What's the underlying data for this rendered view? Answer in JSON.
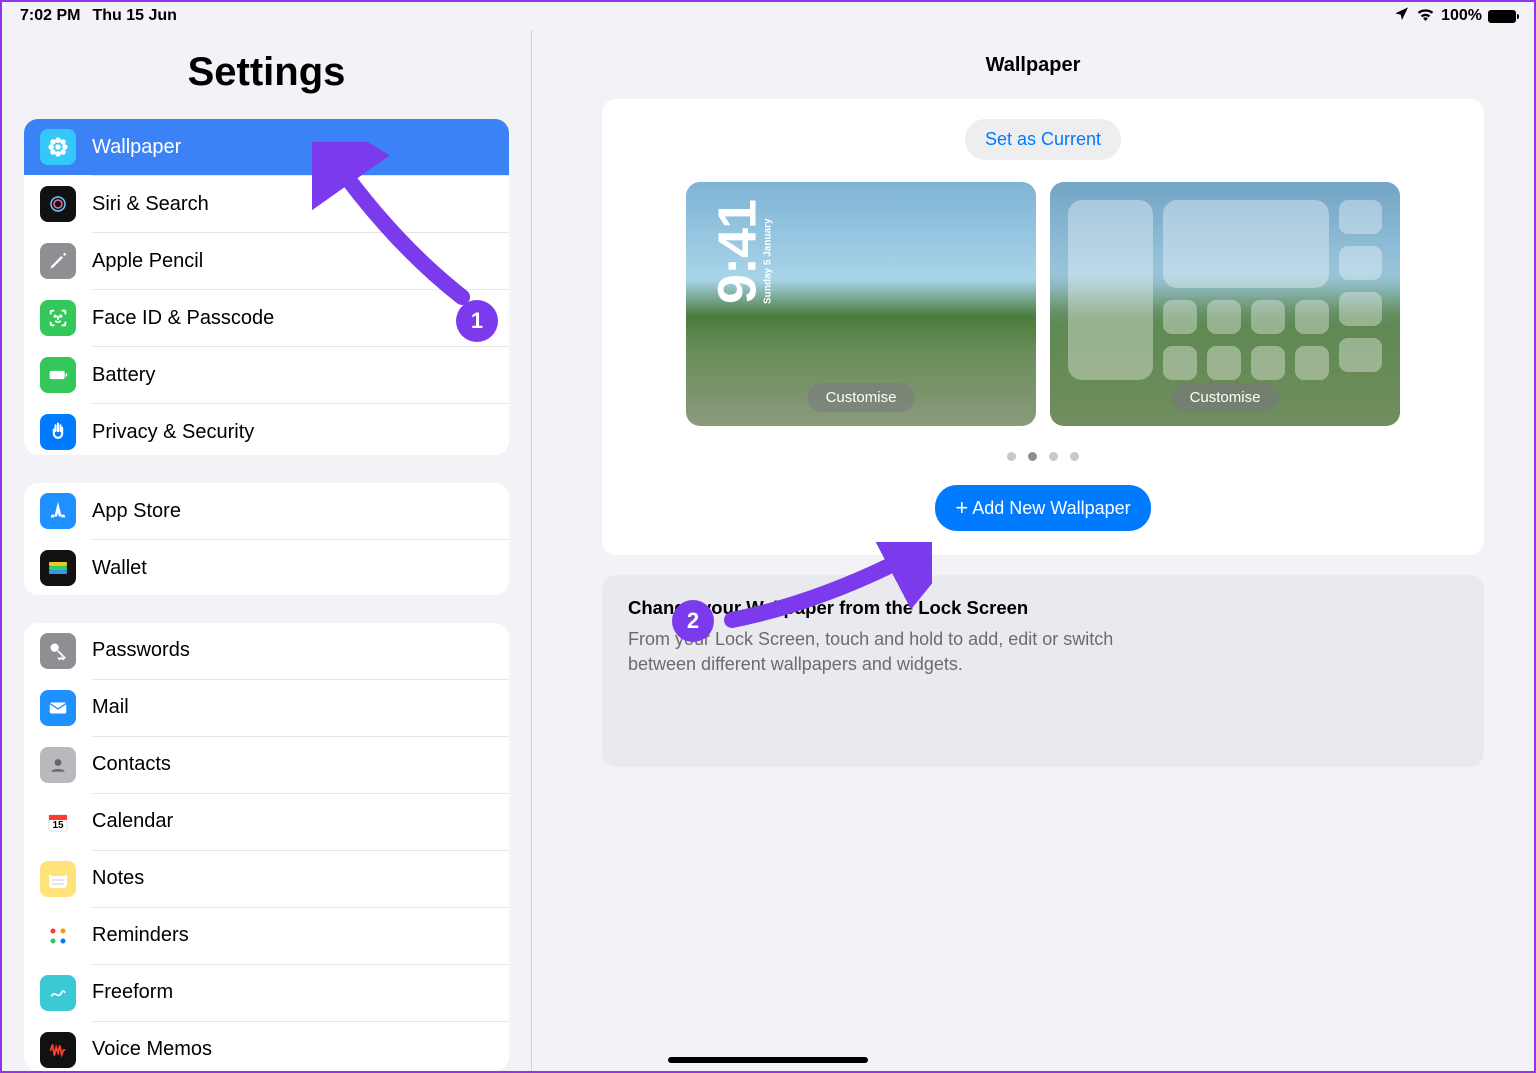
{
  "status": {
    "time": "7:02 PM",
    "date": "Thu 15 Jun",
    "battery": "100%"
  },
  "sidebar": {
    "title": "Settings",
    "g1": [
      {
        "label": "Wallpaper",
        "icon": "flower-icon",
        "bg": "#34c8fa",
        "selected": true
      },
      {
        "label": "Siri & Search",
        "icon": "siri-icon",
        "bg": "#111"
      },
      {
        "label": "Apple Pencil",
        "icon": "pencil-icon",
        "bg": "#8e8e93"
      },
      {
        "label": "Face ID & Passcode",
        "icon": "faceid-icon",
        "bg": "#34c759"
      },
      {
        "label": "Battery",
        "icon": "battery-icon",
        "bg": "#34c759"
      },
      {
        "label": "Privacy & Security",
        "icon": "hand-icon",
        "bg": "#007aff"
      }
    ],
    "g2": [
      {
        "label": "App Store",
        "icon": "appstore-icon",
        "bg": "#1e90ff"
      },
      {
        "label": "Wallet",
        "icon": "wallet-icon",
        "bg": "#111"
      }
    ],
    "g3": [
      {
        "label": "Passwords",
        "icon": "key-icon",
        "bg": "#8e8e93"
      },
      {
        "label": "Mail",
        "icon": "mail-icon",
        "bg": "#1e90ff"
      },
      {
        "label": "Contacts",
        "icon": "contacts-icon",
        "bg": "#b8b8bd"
      },
      {
        "label": "Calendar",
        "icon": "calendar-icon",
        "bg": "#fff"
      },
      {
        "label": "Notes",
        "icon": "notes-icon",
        "bg": "#ffe27a"
      },
      {
        "label": "Reminders",
        "icon": "reminders-icon",
        "bg": "#fff"
      },
      {
        "label": "Freeform",
        "icon": "freeform-icon",
        "bg": "#3cc9d6"
      },
      {
        "label": "Voice Memos",
        "icon": "voicememos-icon",
        "bg": "#111"
      }
    ]
  },
  "main": {
    "title": "Wallpaper",
    "set_current": "Set as Current",
    "customise": "Customise",
    "lock_time": "9:41",
    "lock_day": "Sunday 5 January",
    "add_new": "Add New Wallpaper",
    "info_title": "Change your Wallpaper from the Lock Screen",
    "info_desc": "From your Lock Screen, touch and hold to add, edit or switch between different wallpapers and widgets."
  },
  "annot": {
    "one": "1",
    "two": "2"
  }
}
